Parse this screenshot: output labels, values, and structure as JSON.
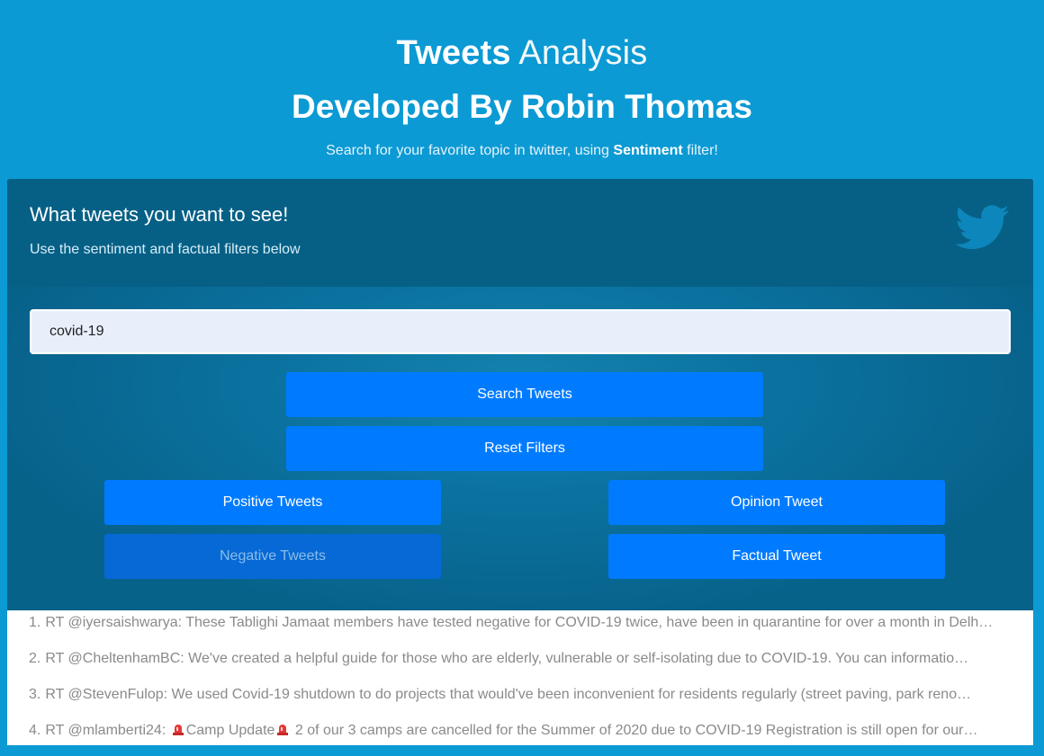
{
  "header": {
    "title_bold": "Tweets",
    "title_light": "Analysis",
    "subtitle": "Developed By Robin Thomas",
    "tagline_pre": "Search for your favorite topic in twitter, using ",
    "tagline_bold": "Sentiment",
    "tagline_post": " filter!"
  },
  "panel": {
    "title": "What tweets you want to see!",
    "subtitle": "Use the sentiment and factual filters below",
    "icon": "twitter-bird-icon"
  },
  "search": {
    "value": "covid-19",
    "placeholder": ""
  },
  "buttons": {
    "search": "Search Tweets",
    "reset": "Reset Filters",
    "positive": "Positive Tweets",
    "negative": "Negative Tweets",
    "opinion": "Opinion Tweet",
    "factual": "Factual Tweet"
  },
  "tweets": [
    {
      "num": "1.",
      "text": "RT @iyersaishwarya: These Tablighi Jamaat members have tested negative for COVID-19 twice, have been in quarantine for over a month in Delh…"
    },
    {
      "num": "2.",
      "text": "RT @CheltenhamBC: We've created a helpful guide for those who are elderly, vulnerable or self-isolating due to COVID-19. You can informatio…"
    },
    {
      "num": "3.",
      "text": "RT @StevenFulop: We used Covid-19 shutdown to do projects that would've been inconvenient for residents regularly (street paving, park reno…"
    },
    {
      "num": "4.",
      "text_pre": "RT @mlamberti24: ",
      "text_mid": "Camp Update",
      "text_post": " 2 of our 3 camps are cancelled for the Summer of 2020 due to COVID-19 Registration is still open for our…",
      "icon": "siren-icon"
    }
  ],
  "colors": {
    "background": "#0b9ad4",
    "panel": "#07628a",
    "button": "#007bff",
    "button_disabled": "#0669d6"
  }
}
